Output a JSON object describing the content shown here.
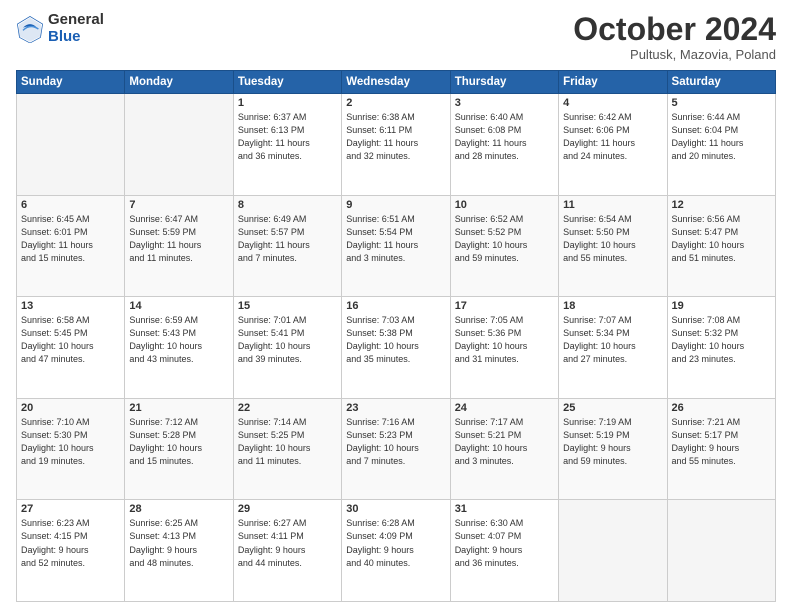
{
  "logo": {
    "general": "General",
    "blue": "Blue"
  },
  "header": {
    "month": "October 2024",
    "location": "Pultusk, Mazovia, Poland"
  },
  "weekdays": [
    "Sunday",
    "Monday",
    "Tuesday",
    "Wednesday",
    "Thursday",
    "Friday",
    "Saturday"
  ],
  "weeks": [
    [
      {
        "day": "",
        "info": ""
      },
      {
        "day": "",
        "info": ""
      },
      {
        "day": "1",
        "info": "Sunrise: 6:37 AM\nSunset: 6:13 PM\nDaylight: 11 hours\nand 36 minutes."
      },
      {
        "day": "2",
        "info": "Sunrise: 6:38 AM\nSunset: 6:11 PM\nDaylight: 11 hours\nand 32 minutes."
      },
      {
        "day": "3",
        "info": "Sunrise: 6:40 AM\nSunset: 6:08 PM\nDaylight: 11 hours\nand 28 minutes."
      },
      {
        "day": "4",
        "info": "Sunrise: 6:42 AM\nSunset: 6:06 PM\nDaylight: 11 hours\nand 24 minutes."
      },
      {
        "day": "5",
        "info": "Sunrise: 6:44 AM\nSunset: 6:04 PM\nDaylight: 11 hours\nand 20 minutes."
      }
    ],
    [
      {
        "day": "6",
        "info": "Sunrise: 6:45 AM\nSunset: 6:01 PM\nDaylight: 11 hours\nand 15 minutes."
      },
      {
        "day": "7",
        "info": "Sunrise: 6:47 AM\nSunset: 5:59 PM\nDaylight: 11 hours\nand 11 minutes."
      },
      {
        "day": "8",
        "info": "Sunrise: 6:49 AM\nSunset: 5:57 PM\nDaylight: 11 hours\nand 7 minutes."
      },
      {
        "day": "9",
        "info": "Sunrise: 6:51 AM\nSunset: 5:54 PM\nDaylight: 11 hours\nand 3 minutes."
      },
      {
        "day": "10",
        "info": "Sunrise: 6:52 AM\nSunset: 5:52 PM\nDaylight: 10 hours\nand 59 minutes."
      },
      {
        "day": "11",
        "info": "Sunrise: 6:54 AM\nSunset: 5:50 PM\nDaylight: 10 hours\nand 55 minutes."
      },
      {
        "day": "12",
        "info": "Sunrise: 6:56 AM\nSunset: 5:47 PM\nDaylight: 10 hours\nand 51 minutes."
      }
    ],
    [
      {
        "day": "13",
        "info": "Sunrise: 6:58 AM\nSunset: 5:45 PM\nDaylight: 10 hours\nand 47 minutes."
      },
      {
        "day": "14",
        "info": "Sunrise: 6:59 AM\nSunset: 5:43 PM\nDaylight: 10 hours\nand 43 minutes."
      },
      {
        "day": "15",
        "info": "Sunrise: 7:01 AM\nSunset: 5:41 PM\nDaylight: 10 hours\nand 39 minutes."
      },
      {
        "day": "16",
        "info": "Sunrise: 7:03 AM\nSunset: 5:38 PM\nDaylight: 10 hours\nand 35 minutes."
      },
      {
        "day": "17",
        "info": "Sunrise: 7:05 AM\nSunset: 5:36 PM\nDaylight: 10 hours\nand 31 minutes."
      },
      {
        "day": "18",
        "info": "Sunrise: 7:07 AM\nSunset: 5:34 PM\nDaylight: 10 hours\nand 27 minutes."
      },
      {
        "day": "19",
        "info": "Sunrise: 7:08 AM\nSunset: 5:32 PM\nDaylight: 10 hours\nand 23 minutes."
      }
    ],
    [
      {
        "day": "20",
        "info": "Sunrise: 7:10 AM\nSunset: 5:30 PM\nDaylight: 10 hours\nand 19 minutes."
      },
      {
        "day": "21",
        "info": "Sunrise: 7:12 AM\nSunset: 5:28 PM\nDaylight: 10 hours\nand 15 minutes."
      },
      {
        "day": "22",
        "info": "Sunrise: 7:14 AM\nSunset: 5:25 PM\nDaylight: 10 hours\nand 11 minutes."
      },
      {
        "day": "23",
        "info": "Sunrise: 7:16 AM\nSunset: 5:23 PM\nDaylight: 10 hours\nand 7 minutes."
      },
      {
        "day": "24",
        "info": "Sunrise: 7:17 AM\nSunset: 5:21 PM\nDaylight: 10 hours\nand 3 minutes."
      },
      {
        "day": "25",
        "info": "Sunrise: 7:19 AM\nSunset: 5:19 PM\nDaylight: 9 hours\nand 59 minutes."
      },
      {
        "day": "26",
        "info": "Sunrise: 7:21 AM\nSunset: 5:17 PM\nDaylight: 9 hours\nand 55 minutes."
      }
    ],
    [
      {
        "day": "27",
        "info": "Sunrise: 6:23 AM\nSunset: 4:15 PM\nDaylight: 9 hours\nand 52 minutes."
      },
      {
        "day": "28",
        "info": "Sunrise: 6:25 AM\nSunset: 4:13 PM\nDaylight: 9 hours\nand 48 minutes."
      },
      {
        "day": "29",
        "info": "Sunrise: 6:27 AM\nSunset: 4:11 PM\nDaylight: 9 hours\nand 44 minutes."
      },
      {
        "day": "30",
        "info": "Sunrise: 6:28 AM\nSunset: 4:09 PM\nDaylight: 9 hours\nand 40 minutes."
      },
      {
        "day": "31",
        "info": "Sunrise: 6:30 AM\nSunset: 4:07 PM\nDaylight: 9 hours\nand 36 minutes."
      },
      {
        "day": "",
        "info": ""
      },
      {
        "day": "",
        "info": ""
      }
    ]
  ]
}
